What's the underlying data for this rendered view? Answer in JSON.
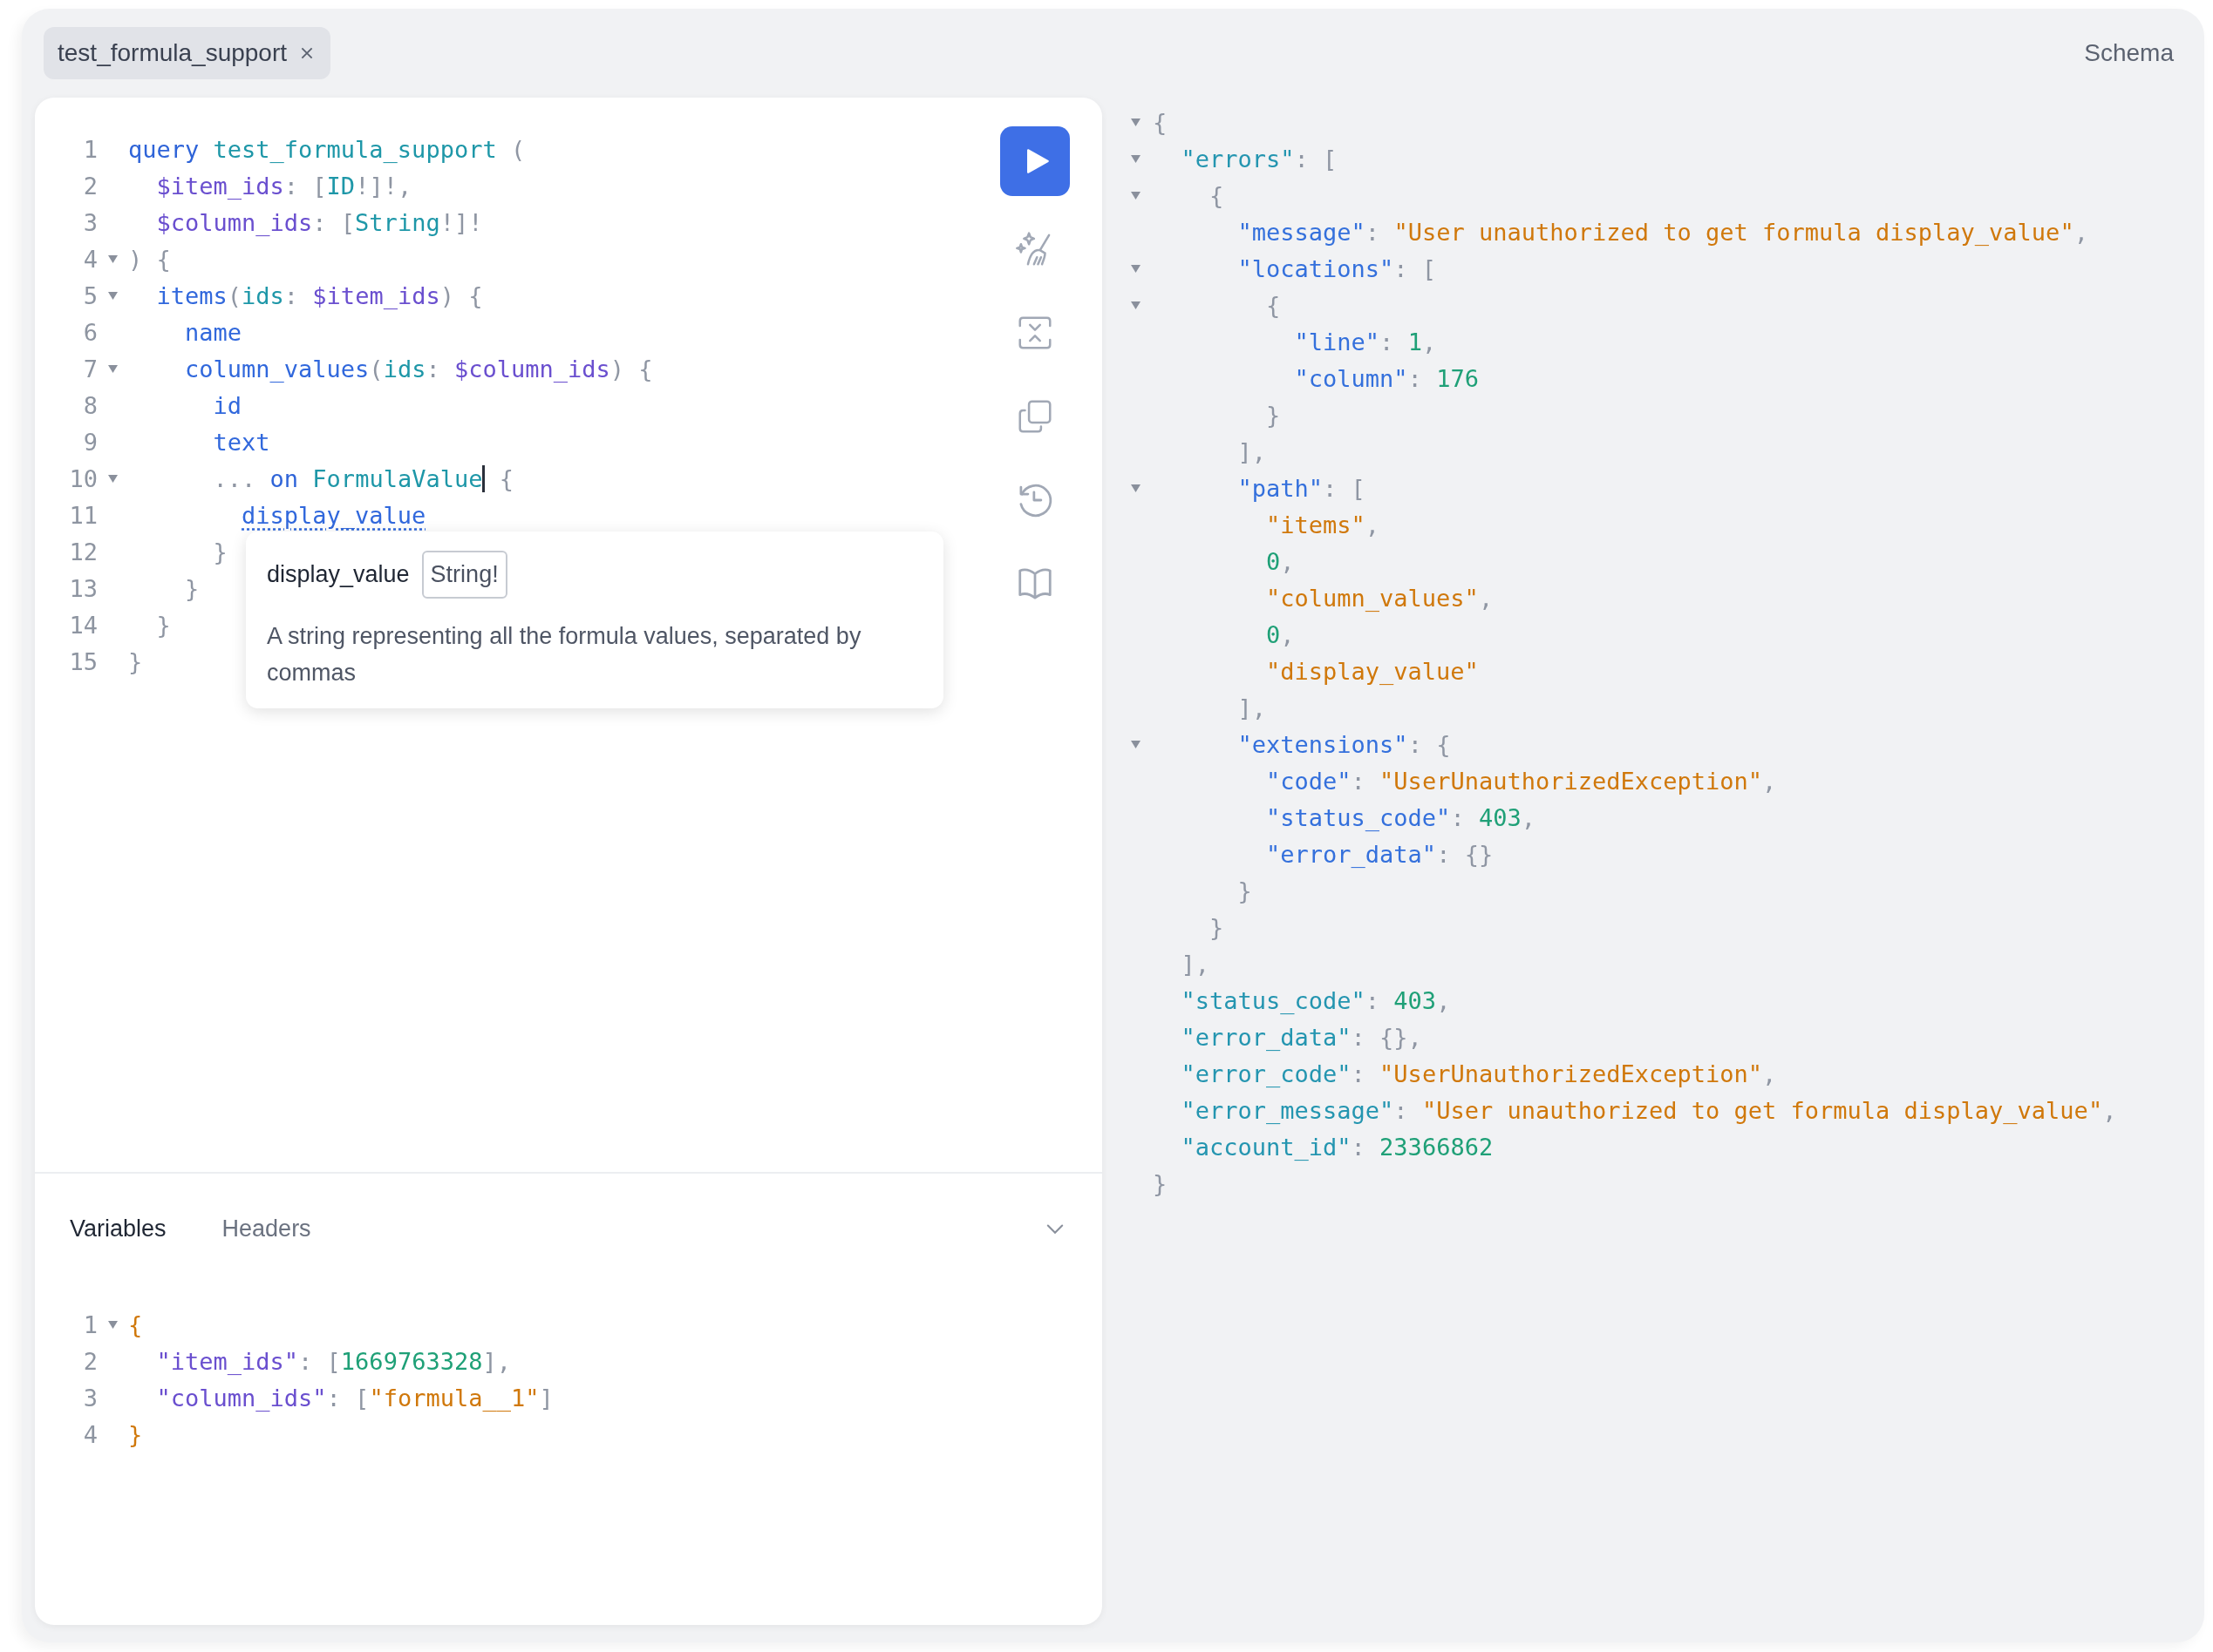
{
  "tab": {
    "label": "test_formula_support"
  },
  "schema_link": "Schema",
  "editor": {
    "lines": [
      {
        "n": "1",
        "fold": false,
        "tokens": [
          {
            "t": "query ",
            "kind": "kw"
          },
          {
            "t": "test_formula_support ",
            "kind": "def"
          },
          {
            "t": "(",
            "kind": "punct"
          }
        ]
      },
      {
        "n": "2",
        "fold": false,
        "tokens": [
          {
            "t": "  $item_ids",
            "kind": "var"
          },
          {
            "t": ": [",
            "kind": "punct"
          },
          {
            "t": "ID",
            "kind": "type"
          },
          {
            "t": "!]!,",
            "kind": "punct"
          }
        ]
      },
      {
        "n": "3",
        "fold": false,
        "tokens": [
          {
            "t": "  $column_ids",
            "kind": "var"
          },
          {
            "t": ": [",
            "kind": "punct"
          },
          {
            "t": "String",
            "kind": "type"
          },
          {
            "t": "!]!",
            "kind": "punct"
          }
        ]
      },
      {
        "n": "4",
        "fold": true,
        "tokens": [
          {
            "t": ") {",
            "kind": "punct"
          }
        ]
      },
      {
        "n": "5",
        "fold": true,
        "tokens": [
          {
            "t": "  items",
            "kind": "field"
          },
          {
            "t": "(",
            "kind": "punct"
          },
          {
            "t": "ids",
            "kind": "attr"
          },
          {
            "t": ": ",
            "kind": "punct"
          },
          {
            "t": "$item_ids",
            "kind": "var"
          },
          {
            "t": ") {",
            "kind": "punct"
          }
        ]
      },
      {
        "n": "6",
        "fold": false,
        "tokens": [
          {
            "t": "    name",
            "kind": "field"
          }
        ]
      },
      {
        "n": "7",
        "fold": true,
        "tokens": [
          {
            "t": "    column_values",
            "kind": "field"
          },
          {
            "t": "(",
            "kind": "punct"
          },
          {
            "t": "ids",
            "kind": "attr"
          },
          {
            "t": ": ",
            "kind": "punct"
          },
          {
            "t": "$column_ids",
            "kind": "var"
          },
          {
            "t": ") {",
            "kind": "punct"
          }
        ]
      },
      {
        "n": "8",
        "fold": false,
        "tokens": [
          {
            "t": "      id",
            "kind": "field"
          }
        ]
      },
      {
        "n": "9",
        "fold": false,
        "tokens": [
          {
            "t": "      text",
            "kind": "field"
          }
        ]
      },
      {
        "n": "10",
        "fold": true,
        "tokens": [
          {
            "t": "      ... ",
            "kind": "punct"
          },
          {
            "t": "on ",
            "kind": "kw"
          },
          {
            "t": "FormulaValue",
            "kind": "def",
            "caret": true
          },
          {
            "t": " {",
            "kind": "punct"
          }
        ]
      },
      {
        "n": "11",
        "fold": false,
        "tokens": [
          {
            "t": "        display_value",
            "kind": "link"
          }
        ]
      },
      {
        "n": "12",
        "fold": false,
        "tokens": [
          {
            "t": "      }",
            "kind": "punct"
          }
        ]
      },
      {
        "n": "13",
        "fold": false,
        "tokens": [
          {
            "t": "    }",
            "kind": "punct"
          }
        ]
      },
      {
        "n": "14",
        "fold": false,
        "tokens": [
          {
            "t": "  }",
            "kind": "punct"
          }
        ]
      },
      {
        "n": "15",
        "fold": false,
        "tokens": [
          {
            "t": "}",
            "kind": "punct"
          }
        ]
      }
    ]
  },
  "tooltip": {
    "name": "display_value",
    "type": "String!",
    "description": "A string representing all the formula values, separated by commas"
  },
  "variables_panel": {
    "tabs": [
      {
        "label": "Variables",
        "selected": true
      },
      {
        "label": "Headers",
        "selected": false
      }
    ],
    "lines": [
      {
        "n": "1",
        "fold": true,
        "tokens": [
          {
            "t": "{",
            "kind": "brace"
          }
        ]
      },
      {
        "n": "2",
        "fold": false,
        "tokens": [
          {
            "t": "  \"item_ids\"",
            "kind": "var"
          },
          {
            "t": ": [",
            "kind": "punct"
          },
          {
            "t": "1669763328",
            "kind": "num"
          },
          {
            "t": "],",
            "kind": "punct"
          }
        ]
      },
      {
        "n": "3",
        "fold": false,
        "tokens": [
          {
            "t": "  \"column_ids\"",
            "kind": "var"
          },
          {
            "t": ": [",
            "kind": "punct"
          },
          {
            "t": "\"formula__1\"",
            "kind": "str"
          },
          {
            "t": "]",
            "kind": "punct"
          }
        ]
      },
      {
        "n": "4",
        "fold": false,
        "tokens": [
          {
            "t": "}",
            "kind": "brace"
          }
        ]
      }
    ]
  },
  "response": {
    "lines": [
      {
        "fold": true,
        "tokens": [
          {
            "t": "{",
            "kind": "punct"
          }
        ]
      },
      {
        "fold": true,
        "tokens": [
          {
            "t": "  \"errors\"",
            "kind": "topkey"
          },
          {
            "t": ": [",
            "kind": "punct"
          }
        ]
      },
      {
        "fold": true,
        "tokens": [
          {
            "t": "    {",
            "kind": "punct"
          }
        ]
      },
      {
        "fold": false,
        "tokens": [
          {
            "t": "      \"message\"",
            "kind": "key"
          },
          {
            "t": ": ",
            "kind": "punct"
          },
          {
            "t": "\"User unauthorized to get formula display_value\"",
            "kind": "str"
          },
          {
            "t": ",",
            "kind": "punct"
          }
        ]
      },
      {
        "fold": true,
        "tokens": [
          {
            "t": "      \"locations\"",
            "kind": "key"
          },
          {
            "t": ": [",
            "kind": "punct"
          }
        ]
      },
      {
        "fold": true,
        "tokens": [
          {
            "t": "        {",
            "kind": "punct"
          }
        ]
      },
      {
        "fold": false,
        "tokens": [
          {
            "t": "          \"line\"",
            "kind": "key"
          },
          {
            "t": ": ",
            "kind": "punct"
          },
          {
            "t": "1",
            "kind": "num"
          },
          {
            "t": ",",
            "kind": "punct"
          }
        ]
      },
      {
        "fold": false,
        "tokens": [
          {
            "t": "          \"column\"",
            "kind": "key"
          },
          {
            "t": ": ",
            "kind": "punct"
          },
          {
            "t": "176",
            "kind": "num"
          }
        ]
      },
      {
        "fold": false,
        "tokens": [
          {
            "t": "        }",
            "kind": "punct"
          }
        ]
      },
      {
        "fold": false,
        "tokens": [
          {
            "t": "      ],",
            "kind": "punct"
          }
        ]
      },
      {
        "fold": true,
        "tokens": [
          {
            "t": "      \"path\"",
            "kind": "key"
          },
          {
            "t": ": [",
            "kind": "punct"
          }
        ]
      },
      {
        "fold": false,
        "tokens": [
          {
            "t": "        \"items\"",
            "kind": "str"
          },
          {
            "t": ",",
            "kind": "punct"
          }
        ]
      },
      {
        "fold": false,
        "tokens": [
          {
            "t": "        0",
            "kind": "num"
          },
          {
            "t": ",",
            "kind": "punct"
          }
        ]
      },
      {
        "fold": false,
        "tokens": [
          {
            "t": "        \"column_values\"",
            "kind": "str"
          },
          {
            "t": ",",
            "kind": "punct"
          }
        ]
      },
      {
        "fold": false,
        "tokens": [
          {
            "t": "        0",
            "kind": "num"
          },
          {
            "t": ",",
            "kind": "punct"
          }
        ]
      },
      {
        "fold": false,
        "tokens": [
          {
            "t": "        \"display_value\"",
            "kind": "str"
          }
        ]
      },
      {
        "fold": false,
        "tokens": [
          {
            "t": "      ],",
            "kind": "punct"
          }
        ]
      },
      {
        "fold": true,
        "tokens": [
          {
            "t": "      \"extensions\"",
            "kind": "key"
          },
          {
            "t": ": {",
            "kind": "punct"
          }
        ]
      },
      {
        "fold": false,
        "tokens": [
          {
            "t": "        \"code\"",
            "kind": "key"
          },
          {
            "t": ": ",
            "kind": "punct"
          },
          {
            "t": "\"UserUnauthorizedException\"",
            "kind": "str"
          },
          {
            "t": ",",
            "kind": "punct"
          }
        ]
      },
      {
        "fold": false,
        "tokens": [
          {
            "t": "        \"status_code\"",
            "kind": "key"
          },
          {
            "t": ": ",
            "kind": "punct"
          },
          {
            "t": "403",
            "kind": "num"
          },
          {
            "t": ",",
            "kind": "punct"
          }
        ]
      },
      {
        "fold": false,
        "tokens": [
          {
            "t": "        \"error_data\"",
            "kind": "key"
          },
          {
            "t": ": {}",
            "kind": "punct"
          }
        ]
      },
      {
        "fold": false,
        "tokens": [
          {
            "t": "      }",
            "kind": "punct"
          }
        ]
      },
      {
        "fold": false,
        "tokens": [
          {
            "t": "    }",
            "kind": "punct"
          }
        ]
      },
      {
        "fold": false,
        "tokens": [
          {
            "t": "  ],",
            "kind": "punct"
          }
        ]
      },
      {
        "fold": false,
        "tokens": [
          {
            "t": "  \"status_code\"",
            "kind": "topkey"
          },
          {
            "t": ": ",
            "kind": "punct"
          },
          {
            "t": "403",
            "kind": "num"
          },
          {
            "t": ",",
            "kind": "punct"
          }
        ]
      },
      {
        "fold": false,
        "tokens": [
          {
            "t": "  \"error_data\"",
            "kind": "topkey"
          },
          {
            "t": ": {},",
            "kind": "punct"
          }
        ]
      },
      {
        "fold": false,
        "tokens": [
          {
            "t": "  \"error_code\"",
            "kind": "topkey"
          },
          {
            "t": ": ",
            "kind": "punct"
          },
          {
            "t": "\"UserUnauthorizedException\"",
            "kind": "str"
          },
          {
            "t": ",",
            "kind": "punct"
          }
        ]
      },
      {
        "fold": false,
        "tokens": [
          {
            "t": "  \"error_message\"",
            "kind": "topkey"
          },
          {
            "t": ": ",
            "kind": "punct"
          },
          {
            "t": "\"User unauthorized to get formula display_value\"",
            "kind": "str"
          },
          {
            "t": ",",
            "kind": "punct"
          }
        ]
      },
      {
        "fold": false,
        "tokens": [
          {
            "t": "  \"account_id\"",
            "kind": "topkey"
          },
          {
            "t": ": ",
            "kind": "punct"
          },
          {
            "t": "23366862",
            "kind": "num"
          }
        ]
      },
      {
        "fold": false,
        "tokens": [
          {
            "t": "}",
            "kind": "punct"
          }
        ]
      }
    ]
  }
}
